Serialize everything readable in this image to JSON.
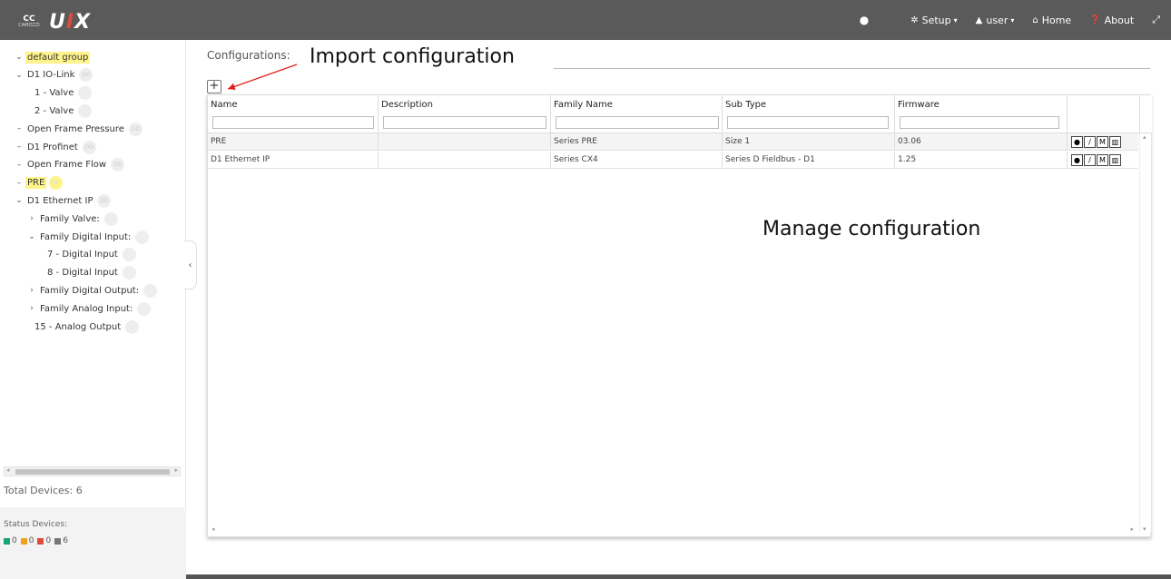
{
  "header": {
    "logo_badge": "CAMOZZI",
    "logo_text_a": "U",
    "logo_text_b": "I",
    "logo_text_c": "X",
    "nav": {
      "setup": "Setup",
      "user": "user",
      "home": "Home",
      "about": "About"
    },
    "icons": [
      "globe-icon",
      "gear-icon",
      "user-icon",
      "home-icon",
      "question-icon",
      "expand-icon"
    ]
  },
  "sidebar": {
    "tree": [
      {
        "label": "default group",
        "highlight": true,
        "dot": false,
        "arrow": "v"
      },
      {
        "label": "D1 IO-Link",
        "highlight": false,
        "dot": true,
        "dot_text": "DD",
        "arrow": "v"
      },
      {
        "label": "1 - Valve",
        "highlight": false,
        "dot": true,
        "dot_text": "",
        "arrow": ""
      },
      {
        "label": "2 - Valve",
        "highlight": false,
        "dot": true,
        "dot_text": "",
        "arrow": ""
      },
      {
        "label": "Open Frame Pressure",
        "highlight": false,
        "dot": true,
        "dot_text": "DD",
        "arrow": "-"
      },
      {
        "label": "D1 Profinet",
        "highlight": false,
        "dot": true,
        "dot_text": "DD",
        "arrow": "-"
      },
      {
        "label": "Open Frame Flow",
        "highlight": false,
        "dot": true,
        "dot_text": "DD",
        "arrow": "-"
      },
      {
        "label": "PRE",
        "highlight": true,
        "dot": true,
        "dot_text": "DD",
        "arrow": "-"
      },
      {
        "label": "D1 Ethernet IP",
        "highlight": false,
        "dot": true,
        "dot_text": "DD",
        "arrow": "v"
      },
      {
        "label": "Family Valve:",
        "highlight": false,
        "dot": true,
        "dot_text": "",
        "arrow": ">"
      },
      {
        "label": "Family Digital Input:",
        "highlight": false,
        "dot": true,
        "dot_text": "",
        "arrow": "v"
      },
      {
        "label": "7 - Digital Input",
        "highlight": false,
        "dot": true,
        "dot_text": "",
        "arrow": ""
      },
      {
        "label": "8 - Digital Input",
        "highlight": false,
        "dot": true,
        "dot_text": "",
        "arrow": ""
      },
      {
        "label": "Family Digital Output:",
        "highlight": false,
        "dot": true,
        "dot_text": "",
        "arrow": ">"
      },
      {
        "label": "Family Analog Input:",
        "highlight": false,
        "dot": true,
        "dot_text": "",
        "arrow": ">"
      },
      {
        "label": "15 - Analog Output",
        "highlight": false,
        "dot": true,
        "dot_text": "",
        "arrow": ""
      }
    ],
    "total_devices": "Total Devices: 6",
    "status_title": "Status Devices:",
    "status_counts": [
      {
        "color": "#1aa37a",
        "value": "0"
      },
      {
        "color": "#f0a01e",
        "value": "0"
      },
      {
        "color": "#e14b3b",
        "value": "0"
      },
      {
        "color": "#777777",
        "value": "6"
      }
    ]
  },
  "main": {
    "title": "Configurations:",
    "import_annotation": "Import configuration",
    "manage_annotation": "Manage configuration",
    "add_button": "+",
    "columns": [
      "Name",
      "Description",
      "Family Name",
      "Sub Type",
      "Firmware"
    ],
    "rows": [
      {
        "name": "PRE",
        "description": "",
        "family": "Series PRE",
        "subtype": "Size 1",
        "firmware": "03.06"
      },
      {
        "name": "D1 Ethernet IP",
        "description": "",
        "family": "Series CX4",
        "subtype": "Series D Fieldbus - D1",
        "firmware": "1.25"
      }
    ],
    "row_actions": [
      "view-icon",
      "edit-icon",
      "download-icon",
      "delete-icon"
    ]
  },
  "colors": {
    "topbar": "#5a5a5a",
    "highlight": "#fff48a",
    "accent": "#e14b3b"
  }
}
